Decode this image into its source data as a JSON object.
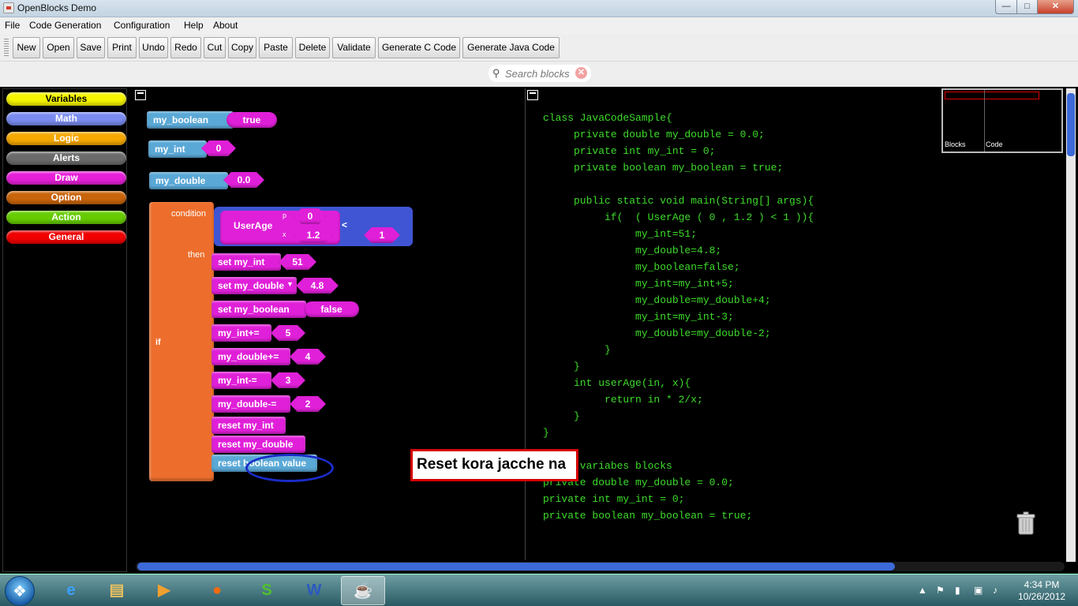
{
  "window": {
    "title": "OpenBlocks Demo",
    "minimize": "—",
    "maximize": "□",
    "close": "✕"
  },
  "menu": [
    "File",
    "Code Generation",
    "Configuration",
    "Help",
    "About"
  ],
  "toolbar": [
    "New",
    "Open",
    "Save",
    "Print",
    "Undo",
    "Redo",
    "Cut",
    "Copy",
    "Paste",
    "Delete",
    "Validate",
    "Generate C Code",
    "Generate Java Code"
  ],
  "search": {
    "placeholder": "Search blocks",
    "clear": "✕"
  },
  "palette": [
    {
      "label": "Variables",
      "color": "#f5f500"
    },
    {
      "label": "Math",
      "color": "#7a8cf0"
    },
    {
      "label": "Logic",
      "color": "#f5a800"
    },
    {
      "label": "Alerts",
      "color": "#6b6b6b"
    },
    {
      "label": "Draw",
      "color": "#e620d8"
    },
    {
      "label": "Option",
      "color": "#c8640a"
    },
    {
      "label": "Action",
      "color": "#66cc00"
    },
    {
      "label": "General",
      "color": "#f00000"
    }
  ],
  "blocks": {
    "my_boolean": "my_boolean",
    "my_boolean_val": "true",
    "my_int": "my_int",
    "my_int_val": "0",
    "my_double": "my_double",
    "my_double_val": "0.0",
    "condition": "condition",
    "then": "then",
    "if": "if",
    "userage": "UserAge",
    "p_label": "p",
    "x_label": "x",
    "p_val": "0",
    "x_val": "1.2",
    "lt": "<",
    "rhs": "1",
    "set_int": "set my_int",
    "set_int_val": "51",
    "set_double": "set my_double",
    "set_double_val": "4.8",
    "set_bool": "set my_boolean",
    "set_bool_val": "false",
    "int_plus": "my_int+=",
    "int_plus_val": "5",
    "double_plus": "my_double+=",
    "double_plus_val": "4",
    "int_minus": "my_int-=",
    "int_minus_val": "3",
    "double_minus": "my_double-=",
    "double_minus_val": "2",
    "reset_int": "reset my_int",
    "reset_double": "reset my_double",
    "reset_bool": "reset boolean value"
  },
  "callout": "Reset kora jacche na",
  "code": "class JavaCodeSample{\n     private double my_double = 0.0;\n     private int my_int = 0;\n     private boolean my_boolean = true;\n\n     public static void main(String[] args){\n          if(  ( UserAge ( 0 , 1.2 ) < 1 )){\n               my_int=51;\n               my_double=4.8;\n               my_boolean=false;\n               my_int=my_int+5;\n               my_double=my_double+4;\n               my_int=my_int-3;\n               my_double=my_double-2;\n          }\n     }\n     int userAge(in, x){\n          return in * 2/x;\n     }\n}\n\n//all variabes blocks\nprivate double my_double = 0.0;\nprivate int my_int = 0;\nprivate boolean my_boolean = true;\n\n\n//all if blocks",
  "minimap": {
    "blocks": "Blocks",
    "code": "Code"
  },
  "taskbar": {
    "time": "4:34 PM",
    "date": "10/26/2012"
  }
}
